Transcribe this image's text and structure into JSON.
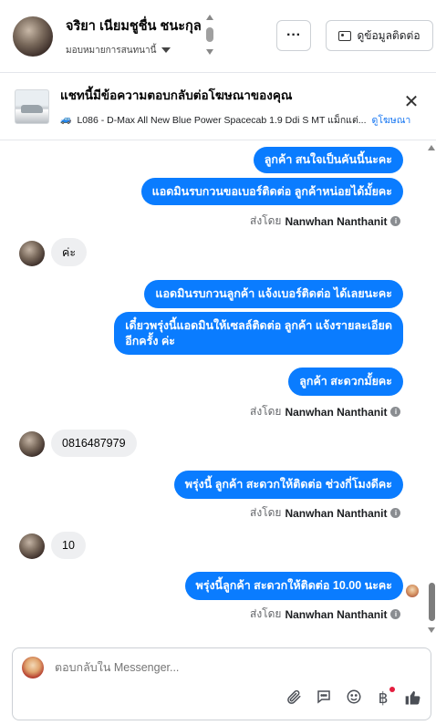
{
  "header": {
    "contact_name": "จริยา เนียมชูชื่น ชนะกุล",
    "assigned_label": "มอบหมายการสนทนานี้",
    "more_label": "···",
    "contact_info_label": "ดูข้อมูลติดต่อ"
  },
  "ad_banner": {
    "title": "แชทนี้มีข้อความตอบกลับต่อโฆษณาของคุณ",
    "ad_text": "L086 - D-Max All New Blue Power Spacecab 1.9 Ddi S MT แม็กแต่...",
    "view_ad_label": "ดูโฆษณา",
    "close_label": "✕"
  },
  "messages": [
    {
      "dir": "out",
      "text": "ลูกค้า สนใจเป็นคันนี้นะคะ"
    },
    {
      "dir": "out",
      "text": "แอดมินรบกวนขอเบอร์ติดต่อ ลูกค้าหน่อยได้มั้ยคะ"
    },
    {
      "dir": "sender",
      "prefix": "ส่งโดย",
      "name": "Nanwhan Nanthanit"
    },
    {
      "dir": "in",
      "text": "ค่ะ"
    },
    {
      "dir": "out",
      "text": "แอดมินรบกวนลูกค้า แจ้งเบอร์ติดต่อ ได้เลยนะคะ"
    },
    {
      "dir": "out",
      "line1": "เดี๋ยวพรุ่งนี้แอดมินให้เซลล์ติดต่อ ลูกค้า แจ้งรายละเอียด",
      "line2": "อีกครั้ง ค่ะ"
    },
    {
      "dir": "out",
      "text": "ลูกค้า สะดวกมั้ยคะ"
    },
    {
      "dir": "sender",
      "prefix": "ส่งโดย",
      "name": "Nanwhan Nanthanit"
    },
    {
      "dir": "in",
      "text": "0816487979"
    },
    {
      "dir": "out",
      "text": "พรุ่งนี้ ลูกค้า สะดวกให้ติดต่อ ช่วงกี่โมงดีคะ"
    },
    {
      "dir": "sender",
      "prefix": "ส่งโดย",
      "name": "Nanwhan Nanthanit"
    },
    {
      "dir": "in",
      "text": "10"
    },
    {
      "dir": "out",
      "text": "พรุ่งนี้ลูกค้า สะดวกให้ติดต่อ 10.00 นะคะ"
    },
    {
      "dir": "sender",
      "prefix": "ส่งโดย",
      "name": "Nanwhan Nanthanit"
    }
  ],
  "composer": {
    "placeholder": "ตอบกลับใน Messenger..."
  },
  "icons": [
    "paperclip-icon",
    "saved-reply-icon",
    "emoji-icon",
    "baht-icon",
    "thumbs-up-icon",
    "info-icon",
    "close-icon",
    "caret-down-icon"
  ],
  "colors": {
    "accent": "#0a7cff",
    "link": "#1877f2",
    "incoming_bubble": "#eeeff1"
  }
}
